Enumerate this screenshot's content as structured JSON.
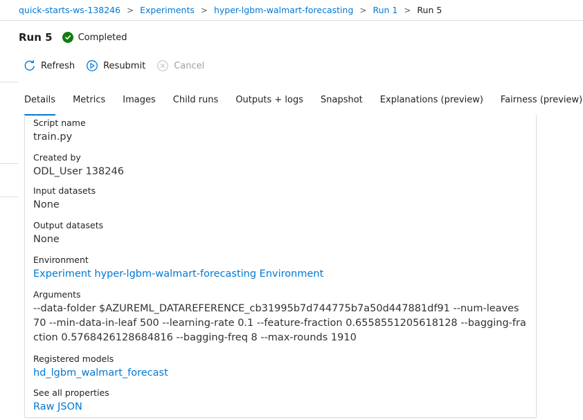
{
  "breadcrumb": {
    "items": [
      "quick-starts-ws-138246",
      "Experiments",
      "hyper-lgbm-walmart-forecasting",
      "Run 1"
    ],
    "current": "Run 5",
    "separator": ">"
  },
  "header": {
    "title": "Run 5",
    "status": "Completed",
    "status_color": "#107c10"
  },
  "toolbar": {
    "refresh": "Refresh",
    "resubmit": "Resubmit",
    "cancel": "Cancel"
  },
  "tabs": [
    {
      "label": "Details",
      "active": true
    },
    {
      "label": "Metrics"
    },
    {
      "label": "Images"
    },
    {
      "label": "Child runs"
    },
    {
      "label": "Outputs + logs"
    },
    {
      "label": "Snapshot"
    },
    {
      "label": "Explanations (preview)"
    },
    {
      "label": "Fairness (preview)"
    }
  ],
  "details": {
    "script_name": {
      "label": "Script name",
      "value": "train.py"
    },
    "created_by": {
      "label": "Created by",
      "value": "ODL_User 138246"
    },
    "input_datasets": {
      "label": "Input datasets",
      "value": "None"
    },
    "output_datasets": {
      "label": "Output datasets",
      "value": "None"
    },
    "environment": {
      "label": "Environment",
      "value": "Experiment hyper-lgbm-walmart-forecasting Environment"
    },
    "arguments": {
      "label": "Arguments",
      "value": "--data-folder $AZUREML_DATAREFERENCE_cb31995b7d744775b7a50d447881df91 --num-leaves 70 --min-data-in-leaf 500 --learning-rate 0.1 --feature-fraction 0.6558551205618128 --bagging-fraction 0.5768426128684816 --bagging-freq 8 --max-rounds 1910"
    },
    "registered_models": {
      "label": "Registered models",
      "value": "hd_lgbm_walmart_forecast"
    },
    "see_all": {
      "label": "See all properties",
      "value": "Raw JSON"
    }
  },
  "colors": {
    "accent": "#0078d4",
    "success": "#107c10",
    "disabled": "#a19f9d"
  }
}
